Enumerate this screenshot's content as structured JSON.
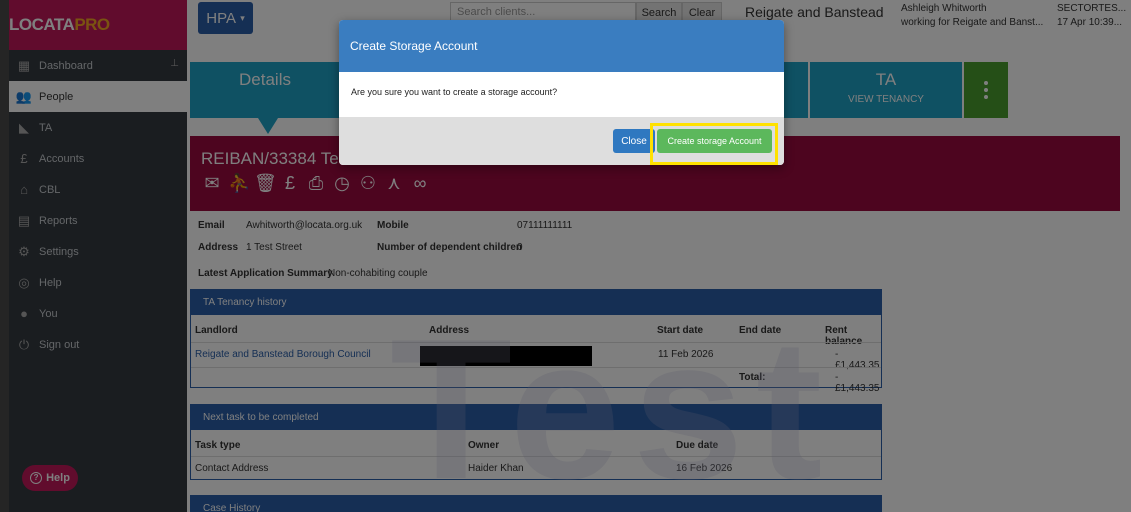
{
  "logo": {
    "part1": "LOCATA",
    "part2": "PRO"
  },
  "sidebar": {
    "items": [
      {
        "label": "Dashboard",
        "icon": "grid-icon"
      },
      {
        "label": "People",
        "icon": "people-icon"
      },
      {
        "label": "TA",
        "icon": "ta-icon"
      },
      {
        "label": "Accounts",
        "icon": "pound-icon"
      },
      {
        "label": "CBL",
        "icon": "home-icon"
      },
      {
        "label": "Reports",
        "icon": "document-icon"
      },
      {
        "label": "Settings",
        "icon": "gear-icon"
      },
      {
        "label": "Help",
        "icon": "lifebuoy-icon"
      },
      {
        "label": "You",
        "icon": "user-icon"
      },
      {
        "label": "Sign out",
        "icon": "power-icon"
      }
    ],
    "help_button": "Help"
  },
  "topbar": {
    "hpa_label": "HPA",
    "search_placeholder": "Search clients...",
    "search_label": "Search",
    "clear_label": "Clear",
    "org_title": "Reigate and Banstead",
    "user_name": "Ashleigh Whitworth",
    "user_org": "working for Reigate and Banst...",
    "sector": "SECTORTES...",
    "datetime": "17 Apr 10:39..."
  },
  "tiles": {
    "details": "Details",
    "ta_title": "TA",
    "ta_sub": "VIEW TENANCY"
  },
  "client": {
    "title": "REIBAN/33384 Test"
  },
  "details": {
    "email_label": "Email",
    "email": "Awhitworth@locata.org.uk",
    "mobile_label": "Mobile",
    "mobile": "07111111111",
    "address_label": "Address",
    "address": "1 Test Street",
    "dependents_label": "Number of dependent children",
    "dependents": "0",
    "summary_label": "Latest Application Summary",
    "summary": "Non-cohabiting couple"
  },
  "tenancy": {
    "heading": "TA Tenancy history",
    "columns": [
      "Landlord",
      "Address",
      "Start date",
      "End date",
      "Rent balance"
    ],
    "row": {
      "landlord": "Reigate and Banstead Borough Council",
      "start": "11 Feb 2026",
      "end": "",
      "balance": "-£1,443.35"
    },
    "total_label": "Total:",
    "total": "-£1,443.35"
  },
  "tasks": {
    "heading": "Next task to be completed",
    "columns": [
      "Task type",
      "Owner",
      "Due date"
    ],
    "row": {
      "type": "Contact Address",
      "owner": "Haider Khan",
      "due": "16 Feb 2026"
    }
  },
  "case_history": {
    "heading": "Case History"
  },
  "watermark": "Test",
  "modal": {
    "title": "Create Storage Account",
    "body": "Are you sure you want to create a storage account?",
    "close_label": "Close",
    "create_label": "Create storage Account"
  }
}
